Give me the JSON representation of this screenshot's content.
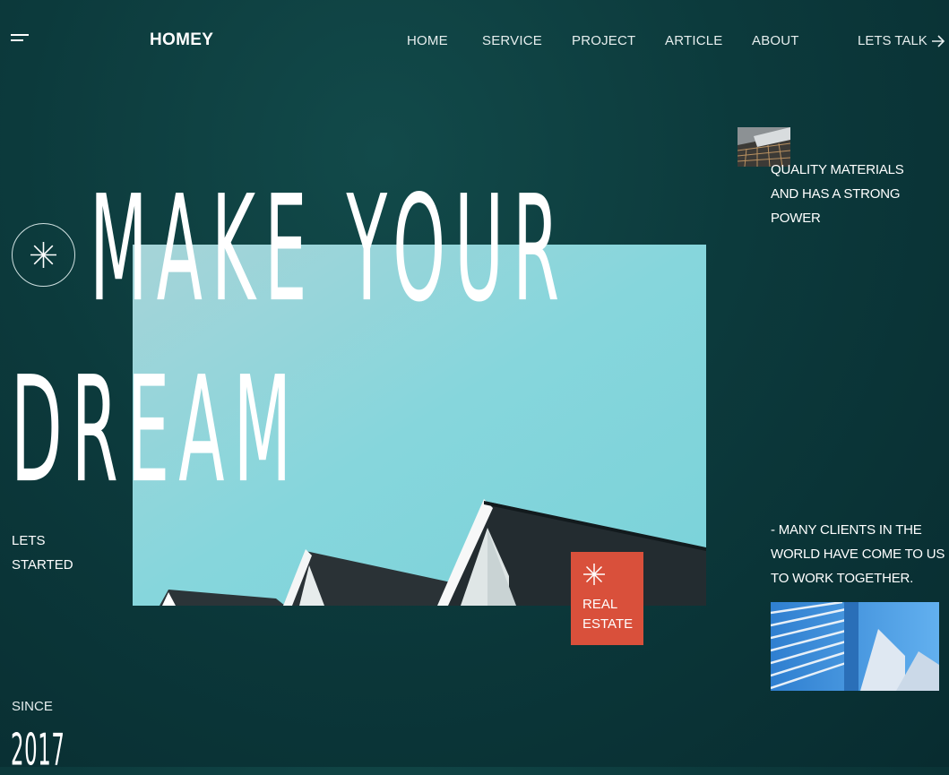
{
  "brand": {
    "logo": "HOMEY"
  },
  "nav": {
    "items": [
      "HOME",
      "SERVICE",
      "PROJECT",
      "ARTICLE",
      "ABOUT"
    ],
    "cta": "LETS TALK"
  },
  "hero": {
    "headline_line1": "MAKE YOUR",
    "headline_line2": "DREAM",
    "cta_line1": "LETS",
    "cta_line2": "STARTED",
    "since_label": "SINCE",
    "since_year": "2017"
  },
  "badge": {
    "line1": "REAL",
    "line2": "ESTATE"
  },
  "side": {
    "quality_text": "QUALITY MATERIALS AND HAS A STRONG POWER",
    "clients_text": "- MANY CLIENTS IN THE WORLD HAVE COME TO US TO WORK TOGETHER."
  },
  "colors": {
    "background": "#0c3a3c",
    "accent": "#d9503b",
    "sky": "#8ad8dd"
  },
  "icons": [
    "menu-icon",
    "arrow-right-icon",
    "asterisk-icon"
  ]
}
